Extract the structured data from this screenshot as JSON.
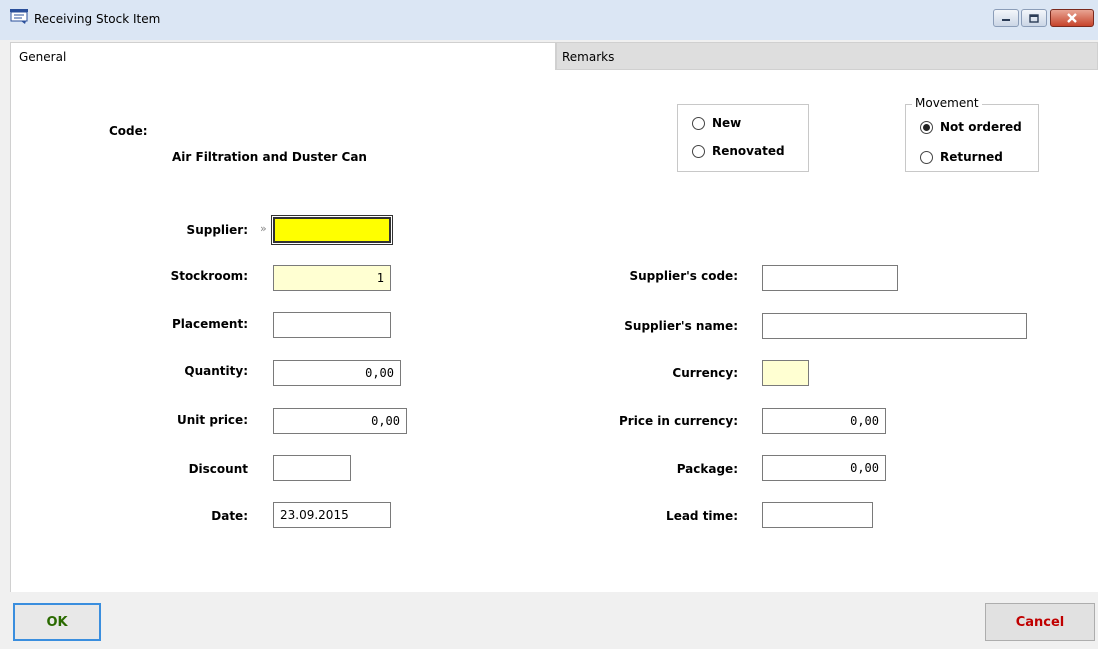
{
  "window": {
    "title": "Receiving Stock Item",
    "icon": "stock-window-icon",
    "controls": {
      "minimize": "minimize-icon",
      "maximize": "maximize-icon",
      "close": "close-icon"
    }
  },
  "tabs": [
    {
      "label": "General",
      "active": true
    },
    {
      "label": "Remarks",
      "active": false
    }
  ],
  "item": {
    "code_label": "Code:",
    "code_value": "",
    "name": "Air Filtration and Duster Can"
  },
  "condition_group": {
    "options": [
      {
        "label": "New",
        "selected": false
      },
      {
        "label": "Renovated",
        "selected": false
      }
    ]
  },
  "movement_group": {
    "legend": "Movement",
    "options": [
      {
        "label": "Not ordered",
        "selected": true
      },
      {
        "label": "Returned",
        "selected": false
      }
    ]
  },
  "left_fields": {
    "supplier": {
      "label": "Supplier:",
      "value": "",
      "lookup_icon": "»"
    },
    "stockroom": {
      "label": "Stockroom:",
      "value": "1"
    },
    "placement": {
      "label": "Placement:",
      "value": ""
    },
    "quantity": {
      "label": "Quantity:",
      "value": "0,00"
    },
    "unit_price": {
      "label": "Unit price:",
      "value": "0,00"
    },
    "discount": {
      "label": "Discount",
      "value": ""
    },
    "date": {
      "label": "Date:",
      "value": "23.09.2015"
    }
  },
  "right_fields": {
    "supplier_code": {
      "label": "Supplier's code:",
      "value": ""
    },
    "supplier_name": {
      "label": "Supplier's name:",
      "value": ""
    },
    "currency": {
      "label": "Currency:",
      "value": ""
    },
    "price_in_currency": {
      "label": "Price in currency:",
      "value": "0,00"
    },
    "package": {
      "label": "Package:",
      "value": "0,00"
    },
    "lead_time": {
      "label": "Lead time:",
      "value": ""
    }
  },
  "buttons": {
    "ok": "OK",
    "cancel": "Cancel"
  },
  "colors": {
    "titlebar": "#dbe6f4",
    "required_field": "#ffff00",
    "readonly_field": "#ffffd2",
    "ok_text": "#2a6a00",
    "cancel_text": "#c00000",
    "focus_border": "#3a8ede"
  }
}
